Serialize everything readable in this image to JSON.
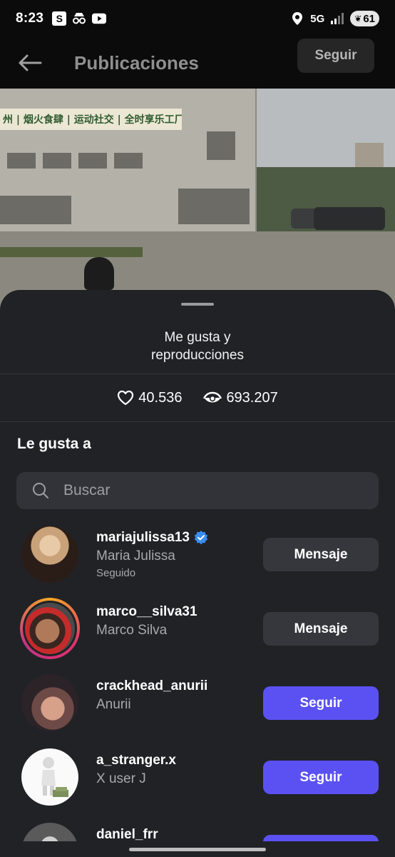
{
  "status_bar": {
    "time": "8:23",
    "app_badge": "S",
    "network": "5G",
    "battery": "61"
  },
  "header": {
    "title": "Publicaciones",
    "follow_label": "Seguir"
  },
  "video": {
    "banner_text": "州 | 烟火食肆 | 运动社交 | 全时享乐工厂"
  },
  "sheet": {
    "title_line1": "Me gusta y",
    "title_line2": "reproducciones",
    "likes": "40.536",
    "views": "693.207",
    "section_title": "Le gusta a",
    "search_placeholder": "Buscar"
  },
  "users": [
    {
      "username": "mariajulissa13",
      "verified": true,
      "fullname": "Maria Julissa",
      "status": "Seguido",
      "button": "Mensaje"
    },
    {
      "username": "marco__silva31",
      "verified": false,
      "fullname": "Marco Silva",
      "status": "",
      "button": "Mensaje"
    },
    {
      "username": "crackhead_anurii",
      "verified": false,
      "fullname": "Anurii",
      "status": "",
      "button": "Seguir"
    },
    {
      "username": "a_stranger.x",
      "verified": false,
      "fullname": "X user J",
      "status": "",
      "button": "Seguir"
    },
    {
      "username": "daniel_frr",
      "verified": false,
      "fullname": "",
      "status": "",
      "button": "Seguir"
    }
  ],
  "colors": {
    "sheet_bg": "#212226",
    "follow_button": "#5b51f3",
    "message_button": "#36373c",
    "verified_badge": "#3b8cf0"
  }
}
